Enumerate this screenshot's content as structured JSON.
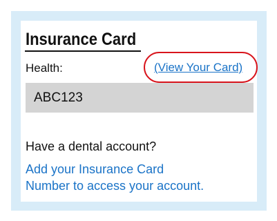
{
  "insurance_card": {
    "title": "Insurance Card",
    "health_label": "Health:",
    "view_card_link": "(View Your Card)",
    "card_number": "ABC123",
    "dental_question": "Have a dental account?",
    "dental_link_line1": "Add your Insurance Card",
    "dental_link_line2": "Number to access your account."
  },
  "colors": {
    "frame_background": "#d8ecf8",
    "link": "#1a73c7",
    "highlight_ring": "#d8141c",
    "number_box": "#d4d4d4"
  }
}
